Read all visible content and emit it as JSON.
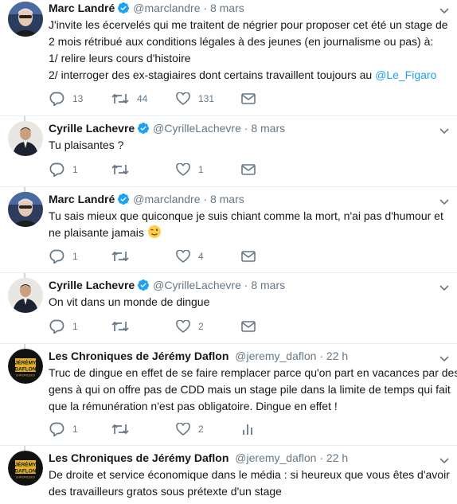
{
  "tweets": [
    {
      "name": "Marc Landré",
      "handle": "@marclandre",
      "separator": "·",
      "time": "8 mars",
      "lines": [
        "J'invite les écervelés qui me traitent de négrier pour proposer cet été un stage de",
        "2 mois rétribué aux conditions légales à des jeunes (en journalisme ou pas) à:",
        "1/ relire leurs cours d'histoire",
        "2/ interroger des ex-stagiaires dont certains travaillent toujours au "
      ],
      "mention": "@Le_Figaro",
      "replies": "13",
      "retweets": "44",
      "likes": "131"
    },
    {
      "name": "Cyrille Lachevre",
      "handle": "@CyrilleLachevre",
      "separator": "·",
      "time": "8 mars",
      "lines": [
        "Tu plaisantes ?"
      ],
      "replies": "1",
      "retweets": "",
      "likes": "1"
    },
    {
      "name": "Marc Landré",
      "handle": "@marclandre",
      "separator": "·",
      "time": "8 mars",
      "lines": [
        "Tu sais mieux que quiconque je suis chiant comme la mort, n'ai pas d'humour et",
        "ne plaisante jamais "
      ],
      "replies": "1",
      "retweets": "",
      "likes": "4"
    },
    {
      "name": "Cyrille Lachevre",
      "handle": "@CyrilleLachevre",
      "separator": "·",
      "time": "8 mars",
      "lines": [
        "On vit dans un monde de dingue"
      ],
      "replies": "1",
      "retweets": "",
      "likes": "2"
    },
    {
      "name": "Les Chroniques de Jérémy Daflon",
      "handle": "@jeremy_daflon",
      "separator": "·",
      "time": "22 h",
      "lines": [
        "Truc de dingue en effet de se faire remplacer parce qu'on part en vacances par des",
        "gens à qui on offre pas de CDD mais un stage pile dans la limite de temps qui fait",
        "que la rémunération n'est pas obligatoire. Dingue en effet !"
      ],
      "replies": "1",
      "retweets": "",
      "likes": "2"
    },
    {
      "name": "Les Chroniques de Jérémy Daflon",
      "handle": "@jeremy_daflon",
      "separator": "·",
      "time": "22 h",
      "lines": [
        "De droite et service économique dans le média : si heureux que vous êtes d'avoir",
        "des travailleurs gratos sous prétexte d'un stage"
      ]
    }
  ],
  "logo_text": [
    "JÉRÉMY",
    "DAFLON",
    "CHRONIQUES"
  ],
  "colors": {
    "text": "#14171a",
    "secondary": "#657786",
    "link": "#1da1f2",
    "verified": "#1da1f2",
    "divider": "#e6ecf0",
    "thread_line": "#ccd6dd"
  }
}
